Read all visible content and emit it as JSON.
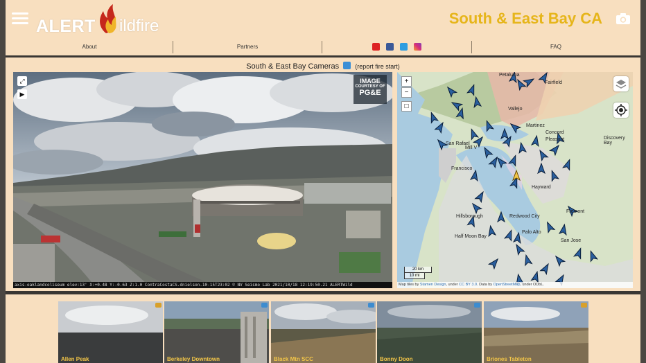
{
  "header": {
    "logo_alert": "ALERT",
    "logo_wildfire": "ildfire",
    "site_title": "South & East Bay CA"
  },
  "nav": {
    "about": "About",
    "partners": "Partners",
    "faq": "FAQ",
    "social_icons": [
      "youtube-icon",
      "facebook-icon",
      "twitter-icon",
      "instagram-icon"
    ]
  },
  "panel": {
    "title": "South & East Bay Cameras",
    "report": "(report fire start)"
  },
  "camera": {
    "badge_line1": "IMAGE",
    "badge_line2": "COURTESY OF",
    "badge_line3": "PG&E",
    "info_strip": "axis-oaklandcoliseum elev:13' X:+0.48 Y:-0.63 Z:1.0 ContraCostaCS.dnielson.10-15T23:02 © NV Seismo Lab 2021/10/18 12:19:50.21 ALERTWild"
  },
  "map": {
    "labels": [
      "Petaluma",
      "Fairfield",
      "Vallejo",
      "Martinez",
      "Concord",
      "Pleasant",
      "Discovery Bay",
      "San Rafael",
      "Mill V",
      "Francisco",
      "Hayward",
      "Fremont",
      "Hillsborough",
      "Redwood City",
      "Palo Alto",
      "Half Moon Bay",
      "San Jose"
    ],
    "scale_km": "20 km",
    "scale_mi": "10 mi",
    "attribution_prefix": "Map tiles by ",
    "attribution_stamen": "Stamen Design",
    "attribution_mid": ", under ",
    "attribution_cc": "CC BY 3.0",
    "attribution_data": ". Data by ",
    "attribution_osm": "OpenStreetMap",
    "attribution_tail": ", under ODbL."
  },
  "thumbnails": [
    {
      "label": "Allen Peak"
    },
    {
      "label": "Berkeley Downtown"
    },
    {
      "label": "Black Mtn SCC"
    },
    {
      "label": "Bonny Doon"
    },
    {
      "label": "Briones Tableton"
    }
  ],
  "colors": {
    "background": "#f8dfbf",
    "title_gold": "#e6b51a",
    "thumb_label": "#f3c648"
  }
}
